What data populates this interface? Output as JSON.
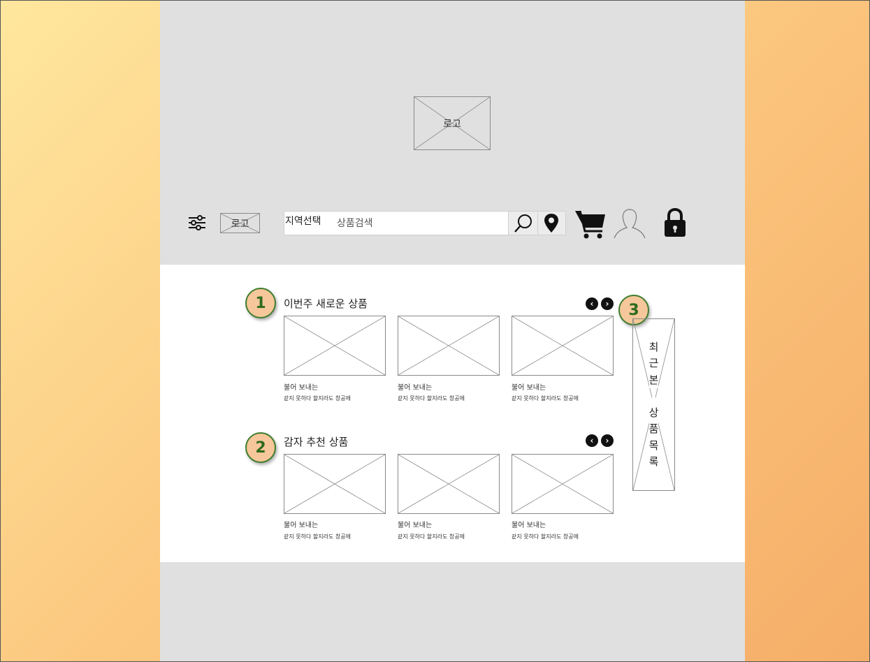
{
  "header": {
    "hero_logo_label": "로고",
    "small_logo_label": "로고",
    "region_label": "지역선택",
    "search_placeholder": "상품검색"
  },
  "icons": {
    "filter": "sliders-icon",
    "search": "search-icon",
    "location": "map-pin-icon",
    "cart": "cart-icon",
    "user": "user-icon",
    "lock": "lock-icon",
    "prev": "chevron-left-icon",
    "next": "chevron-right-icon"
  },
  "sections": [
    {
      "badge": "1",
      "title": "이번주 새로운 상품",
      "items": [
        {
          "title": "불어 보내는",
          "desc": "같지 못하다 할지라도 창공에"
        },
        {
          "title": "불어 보내는",
          "desc": "같지 못하다 할지라도 창공에"
        },
        {
          "title": "불어 보내는",
          "desc": "같지 못하다 할지라도 창공에"
        }
      ]
    },
    {
      "badge": "2",
      "title": "감자 추천 상품",
      "items": [
        {
          "title": "불어 보내는",
          "desc": "같지 못하다 할지라도 창공에"
        },
        {
          "title": "불어 보내는",
          "desc": "같지 못하다 할지라도 창공에"
        },
        {
          "title": "불어 보내는",
          "desc": "같지 못하다 할지라도 창공에"
        }
      ]
    }
  ],
  "recent": {
    "badge": "3",
    "chars": [
      "최",
      "근",
      "본",
      "",
      "상",
      "품",
      "목",
      "록"
    ]
  },
  "colors": {
    "badge_fill": "#f6c79a",
    "badge_border": "#3f7d2e",
    "page_bg": "#e0e0e0"
  }
}
